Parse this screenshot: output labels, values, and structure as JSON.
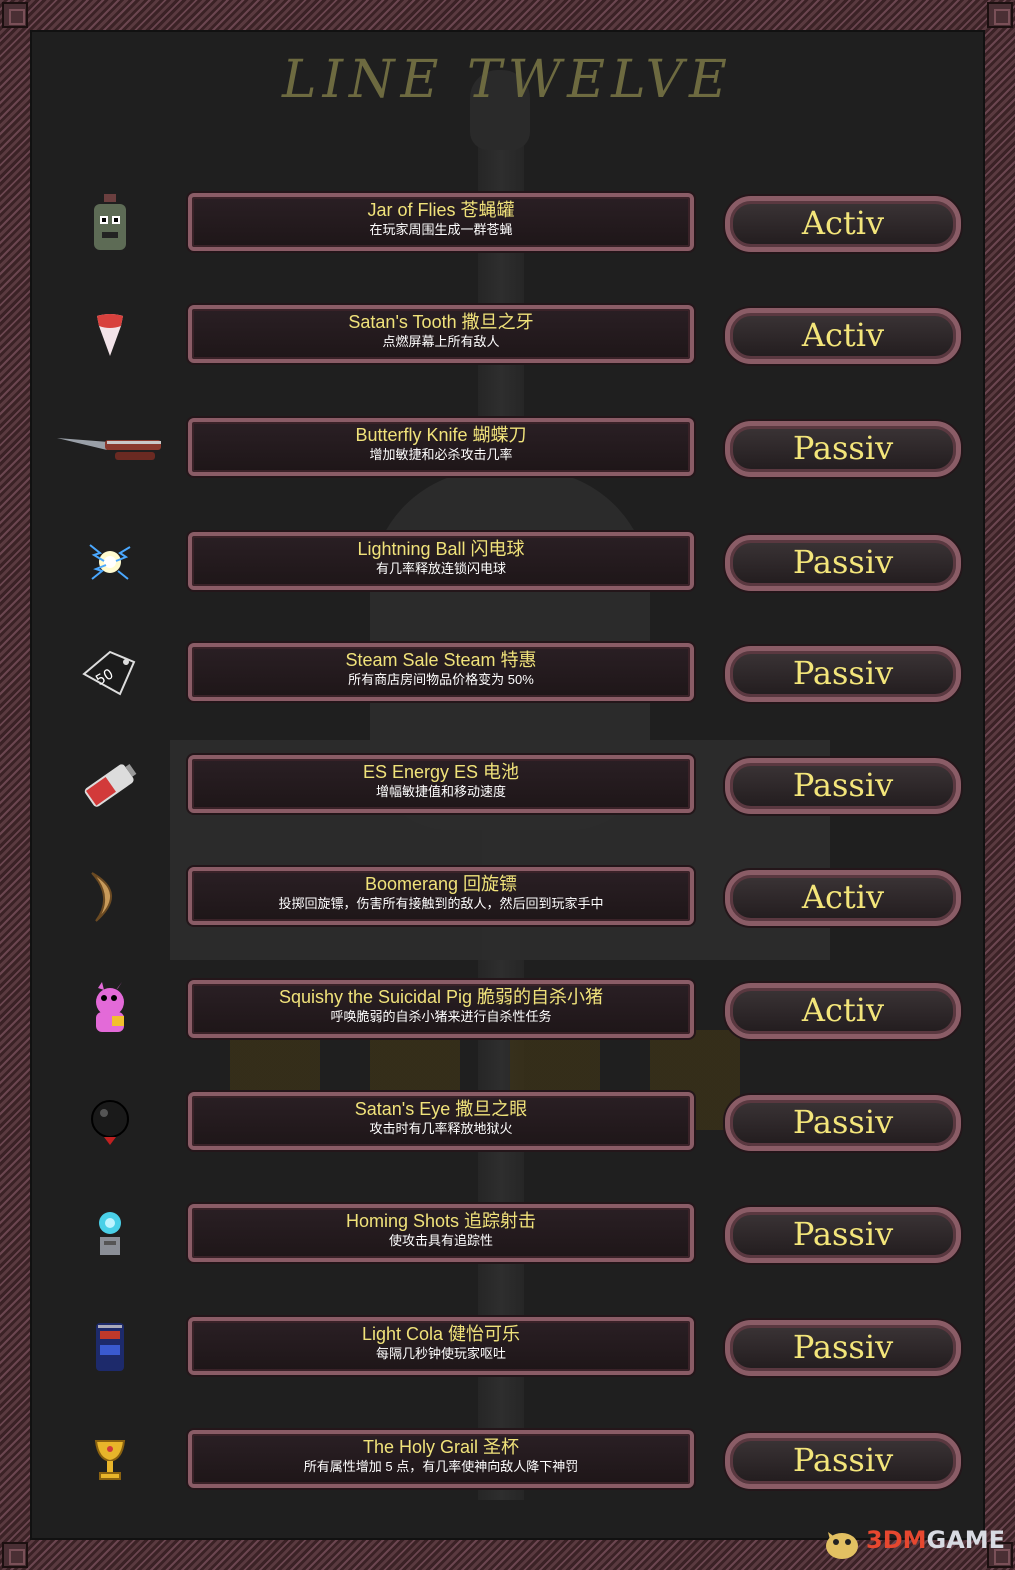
{
  "title": "LINE TWELVE",
  "items": [
    {
      "name": "Jar of Flies 苍蝇罐",
      "desc": "在玩家周围生成一群苍蝇",
      "type": "Activ",
      "icon": "jar-icon"
    },
    {
      "name": "Satan's Tooth 撒旦之牙",
      "desc": "点燃屏幕上所有敌人",
      "type": "Activ",
      "icon": "tooth-icon"
    },
    {
      "name": "Butterfly Knife 蝴蝶刀",
      "desc": "增加敏捷和必杀攻击几率",
      "type": "Passiv",
      "icon": "knife-icon"
    },
    {
      "name": "Lightning Ball 闪电球",
      "desc": "有几率释放连锁闪电球",
      "type": "Passiv",
      "icon": "lightning-ball-icon"
    },
    {
      "name": "Steam Sale Steam 特惠",
      "desc": "所有商店房间物品价格变为 50%",
      "type": "Passiv",
      "icon": "price-tag-icon"
    },
    {
      "name": "ES Energy ES 电池",
      "desc": "增幅敏捷值和移动速度",
      "type": "Passiv",
      "icon": "battery-icon"
    },
    {
      "name": "Boomerang 回旋镖",
      "desc": "投掷回旋镖，伤害所有接触到的敌人，然后回到玩家手中",
      "type": "Activ",
      "icon": "boomerang-icon"
    },
    {
      "name": "Squishy the Suicidal Pig 脆弱的自杀小猪",
      "desc": "呼唤脆弱的自杀小猪来进行自杀性任务",
      "type": "Activ",
      "icon": "pig-icon"
    },
    {
      "name": "Satan's Eye 撒旦之眼",
      "desc": "攻击时有几率释放地狱火",
      "type": "Passiv",
      "icon": "eye-icon"
    },
    {
      "name": "Homing Shots 追踪射击",
      "desc": "使攻击具有追踪性",
      "type": "Passiv",
      "icon": "homing-icon"
    },
    {
      "name": "Light Cola 健怡可乐",
      "desc": "每隔几秒钟使玩家呕吐",
      "type": "Passiv",
      "icon": "cola-can-icon"
    },
    {
      "name": "The Holy Grail 圣杯",
      "desc": "所有属性增加 5 点，有几率使神向敌人降下神罚",
      "type": "Passiv",
      "icon": "grail-icon"
    }
  ],
  "watermark": {
    "prefix": "3DM",
    "suffix": "GAME"
  },
  "colors": {
    "name": "#f0e27a",
    "desc": "#ffffff",
    "badge": "#f3e57a",
    "frame": "#8a5c66"
  }
}
